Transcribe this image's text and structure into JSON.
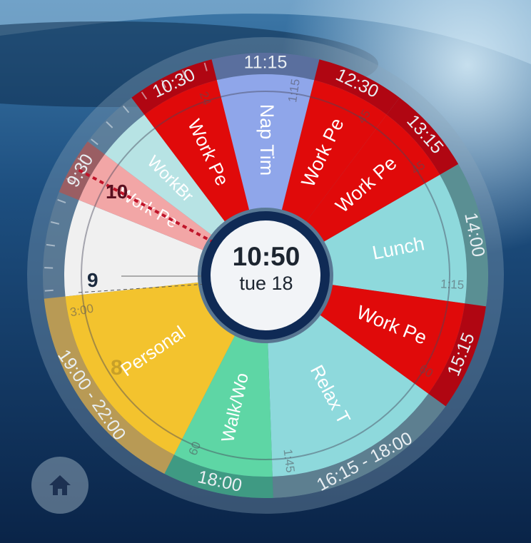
{
  "clock": {
    "time": "10:50",
    "date": "tue 18"
  },
  "colors": {
    "red": "#e00a0a",
    "dark_red": "#b00612",
    "light_red": "#f2a6a6",
    "blue": "#8fa6ea",
    "teal": "#8ed9dc",
    "yellow": "#f3c32e",
    "green": "#5ed6a5",
    "navy": "#0f2a55"
  },
  "segments": [
    {
      "label": "Nap Tim",
      "time": "11:15",
      "duration": "1:15"
    },
    {
      "label": "Work Pe",
      "time": "12:30",
      "duration": "45"
    },
    {
      "label": "Work Pe",
      "time": "13:15",
      "duration": "45"
    },
    {
      "label": "Lunch",
      "time": "14:00",
      "duration": "1:15"
    },
    {
      "label": "Work Pe",
      "time": "15:15",
      "duration": "60"
    },
    {
      "label": "Relax T",
      "time": "16:15 - 18:00",
      "duration": "1:45"
    },
    {
      "label": "Walk/Wo",
      "time": "18:00",
      "duration": "60"
    },
    {
      "label": "Personal",
      "time": "19:00 - 22:00",
      "duration": "3:00"
    },
    {
      "label": "Work Pe",
      "time": "9:30"
    },
    {
      "label": "WorkBr"
    },
    {
      "label": "Work Pe",
      "time": "10:30",
      "duration": "24"
    }
  ],
  "hour_markers": {
    "current_hour": "10",
    "prev_hour": "9",
    "faded_hour": "8"
  },
  "home": {
    "icon": "home-icon"
  }
}
